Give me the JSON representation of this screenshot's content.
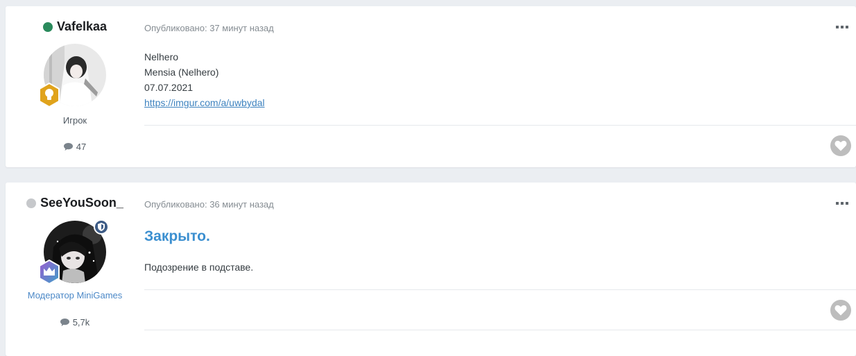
{
  "posts": [
    {
      "author": "Vafelkaa",
      "online": true,
      "status_color": "#2a8a5c",
      "role": "Игрок",
      "role_color": "#4f5861",
      "post_count": "47",
      "rank_icon": "lightbulb-icon",
      "meta": "Опубликовано: 37 минут назад",
      "lines": [
        "Nelhero",
        "Mensia (Nelhero)",
        "07.07.2021"
      ],
      "link": "https://imgur.com/a/uwbydal"
    },
    {
      "author": "SeeYouSoon_",
      "online": false,
      "status_color": "#c6c8cb",
      "role": "Модератор MiniGames",
      "role_color": "#4b88c7",
      "post_count": "5,7k",
      "rank_icon": "crown-icon",
      "meta": "Опубликовано: 36 минут назад",
      "title": "Закрыто.",
      "text": "Подозрение в подставе."
    }
  ]
}
